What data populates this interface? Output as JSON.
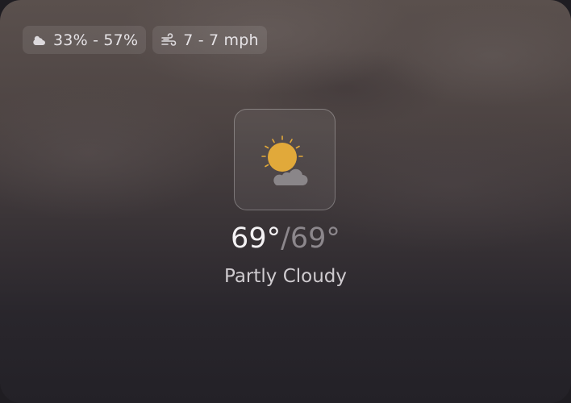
{
  "chips": {
    "precip": {
      "icon": "cloud-sun-icon",
      "text": "33% - 57%"
    },
    "wind": {
      "icon": "wind-icon",
      "text": "7 - 7 mph"
    }
  },
  "weather": {
    "icon": "partly-cloudy-icon",
    "high": "69°",
    "separator": "/",
    "low": "69°",
    "condition": "Partly Cloudy"
  },
  "colors": {
    "sun": "#e1a93a",
    "cloud": "#8a8689"
  }
}
